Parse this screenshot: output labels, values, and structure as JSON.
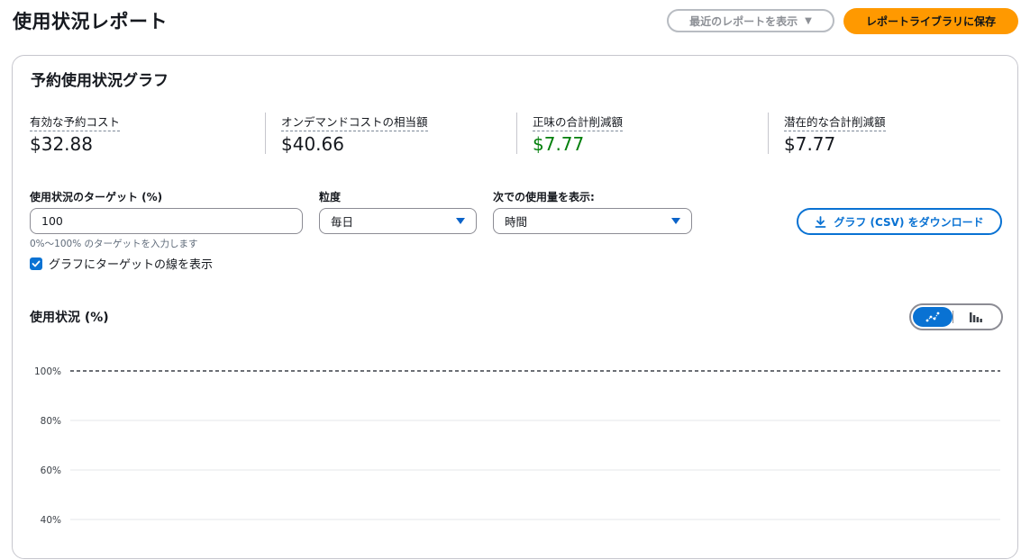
{
  "header": {
    "title": "使用状況レポート",
    "recent_reports_label": "最近のレポートを表示",
    "save_label": "レポートライブラリに保存"
  },
  "card": {
    "title": "予約使用状況グラフ",
    "metrics": [
      {
        "label": "有効な予約コスト",
        "value": "$32.88"
      },
      {
        "label": "オンデマンドコストの相当額",
        "value": "$40.66"
      },
      {
        "label": "正味の合計削減額",
        "value": "$7.77"
      },
      {
        "label": "潜在的な合計削減額",
        "value": "$7.77"
      }
    ],
    "target_field": {
      "label": "使用状況のターゲット (%)",
      "value": "100",
      "hint": "0%～100% のターゲットを入力します"
    },
    "granularity": {
      "label": "粒度",
      "value": "毎日"
    },
    "show_usage_by": {
      "label": "次での使用量を表示:",
      "value": "時間"
    },
    "show_target_line": {
      "label": "グラフにターゲットの線を表示",
      "checked": true
    },
    "download_label": "グラフ (CSV) をダウンロード",
    "usage_section_title": "使用状況 (%)",
    "colors": {
      "accent": "#0972d3",
      "save": "#ff9900",
      "savings": "#037f0c"
    }
  },
  "chart_data": {
    "type": "line",
    "yticks": [
      "100%",
      "80%",
      "60%",
      "40%"
    ],
    "target_line": 100,
    "ylim": [
      40,
      100
    ],
    "series": []
  }
}
